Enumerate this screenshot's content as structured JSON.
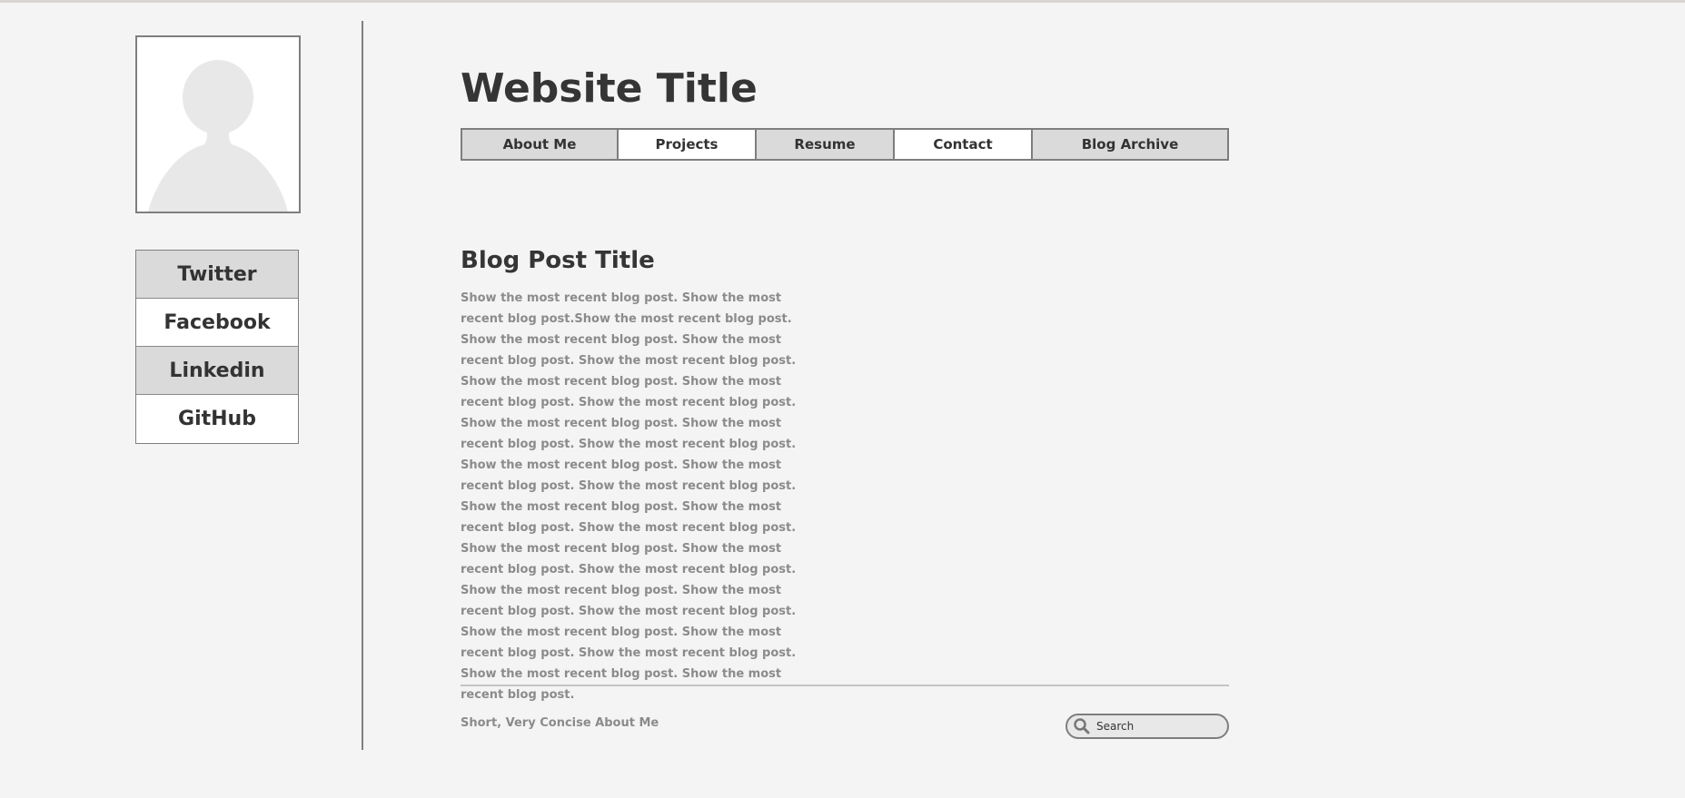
{
  "header": {
    "site_title": "Website Title"
  },
  "nav": {
    "tabs": [
      {
        "label": "About Me"
      },
      {
        "label": "Projects"
      },
      {
        "label": "Resume"
      },
      {
        "label": "Contact"
      },
      {
        "label": "Blog Archive"
      }
    ]
  },
  "sidebar": {
    "avatar_icon": "user-silhouette-icon",
    "social_links": [
      {
        "label": "Twitter"
      },
      {
        "label": "Facebook"
      },
      {
        "label": "Linkedin"
      },
      {
        "label": "GitHub"
      }
    ]
  },
  "post": {
    "title": "Blog Post Title",
    "body": "Show the most recent blog post. Show the most recent blog post.Show the most recent blog post. Show the most recent blog post. Show the most recent blog post. Show the most recent blog post. Show the most recent blog post. Show the most recent blog post. Show the most recent blog post. Show the most recent blog post. Show the most recent blog post. Show the most recent blog post. Show the most recent blog post. Show the most recent blog post. Show the most recent blog post. Show the most recent blog post. Show the most recent blog post. Show the most recent blog post. Show the most recent blog post. Show the most recent blog post. Show the most recent blog post. Show the most recent blog post. Show the most recent blog post. Show the most recent blog post. Show the most recent blog post. Show the most recent blog post. Show the most recent blog post. Show the most recent blog post. Show the most recent blog post."
  },
  "footer": {
    "about_text": "Short, Very Concise About Me",
    "search_placeholder": "Search",
    "search_icon": "search-icon"
  },
  "colors": {
    "background": "#f4f4f4",
    "border": "#7e7e7e",
    "shaded_fill": "#dadada",
    "text_dark": "#333333",
    "text_muted": "#8b8b8b"
  }
}
